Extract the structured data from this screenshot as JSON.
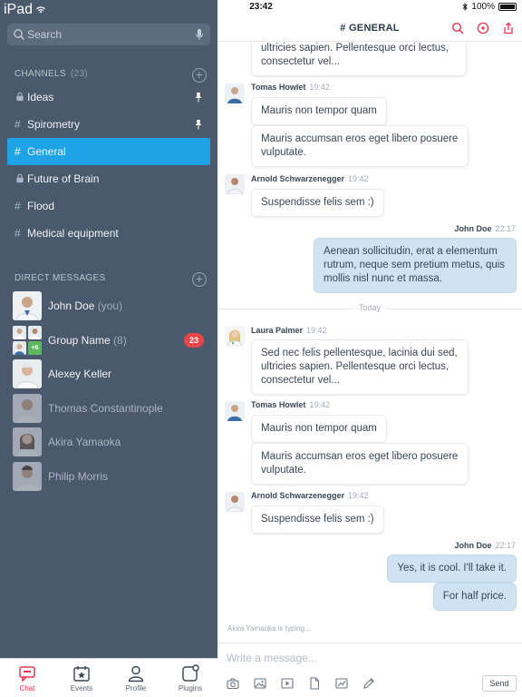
{
  "status_bar": {
    "carrier": "iPad",
    "time": "23:42",
    "battery": "100%"
  },
  "sidebar": {
    "search": {
      "placeholder": "Search"
    },
    "channels_header": {
      "label": "CHANNELS",
      "count": "(23)"
    },
    "channels": [
      {
        "prefix": "lock",
        "name": "Ideas",
        "pinned": true,
        "active": false
      },
      {
        "prefix": "#",
        "name": "Spirometry",
        "pinned": true,
        "active": false
      },
      {
        "prefix": "#",
        "name": "General",
        "pinned": false,
        "active": true
      },
      {
        "prefix": "lock",
        "name": "Future of Brain",
        "pinned": false,
        "active": false
      },
      {
        "prefix": "#",
        "name": "Flood",
        "pinned": false,
        "active": false
      },
      {
        "prefix": "#",
        "name": "Medical equipment",
        "pinned": false,
        "active": false
      }
    ],
    "dm_header": {
      "label": "DIRECT MESSAGES"
    },
    "direct_messages": [
      {
        "name": "John Doe",
        "sub": "(you)",
        "online": true
      },
      {
        "name": "Group Name",
        "sub": "(8)",
        "online": true,
        "badge": "23",
        "group_more": "+6"
      },
      {
        "name": "Alexey Keller",
        "sub": "",
        "online": true
      },
      {
        "name": "Thomas Constantinople",
        "sub": "",
        "online": false
      },
      {
        "name": "Akira Yamaoka",
        "sub": "",
        "online": false
      },
      {
        "name": "Philip Morris",
        "sub": "",
        "online": false
      }
    ]
  },
  "tabbar": {
    "tabs": [
      {
        "label": "Chat",
        "icon": "chat-icon",
        "active": true
      },
      {
        "label": "Events",
        "icon": "calendar-star-icon",
        "active": false
      },
      {
        "label": "Profile",
        "icon": "person-icon",
        "active": false
      },
      {
        "label": "Plugins",
        "icon": "plugin-icon",
        "active": false
      }
    ]
  },
  "chat": {
    "title": "# GENERAL",
    "header_icons": [
      "search-icon",
      "info-icon",
      "share-icon"
    ],
    "messages_top": {
      "partial_bubble": "ultricies sapien. Pellentesque orci lectus, consectetur vel...",
      "tomas": {
        "author": "Tomas Howlet",
        "time": "19:42",
        "bubbles": [
          "Mauris non tempor quam",
          "Mauris accumsan eros eget libero posuere vulputate."
        ]
      },
      "arnold": {
        "author": "Arnold Schwarzenegger",
        "time": "19:42",
        "bubbles": [
          "Suspendisse felis sem :)"
        ]
      },
      "own": {
        "author": "John Doe",
        "time": "22:17",
        "bubbles": [
          "Aenean sollicitudin, erat a elementum rutrum, neque sem pretium metus, quis mollis nisl nunc et massa."
        ]
      }
    },
    "divider_label": "Today",
    "messages_today": {
      "laura": {
        "author": "Laura Palmer",
        "time": "19:42",
        "bubbles": [
          "Sed nec felis pellentesque, lacinia dui sed, ultricies sapien. Pellentesque orci lectus, consectetur vel..."
        ]
      },
      "tomas": {
        "author": "Tomas Howlet",
        "time": "19:42",
        "bubbles": [
          "Mauris non tempor quam",
          "Mauris accumsan eros eget libero posuere vulputate."
        ]
      },
      "arnold": {
        "author": "Arnold Schwarzenegger",
        "time": "19:42",
        "bubbles": [
          "Suspendisse felis sem :)"
        ]
      },
      "own": {
        "author": "John Doe",
        "time": "22:17",
        "bubbles": [
          "Yes, it is cool. I'll take it.",
          "For half price."
        ]
      }
    },
    "typing": "Akira Yamaoka is typing...",
    "composer": {
      "placeholder": "Write a message...",
      "send_label": "Send",
      "tools": [
        "camera-icon",
        "image-icon",
        "video-icon",
        "file-icon",
        "chart-icon",
        "pencil-icon"
      ]
    }
  },
  "colors": {
    "sidebar_bg": "#4a596b",
    "active_channel": "#1ea3e6",
    "accent": "#e8334d",
    "own_bubble": "#cfe3f2",
    "badge": "#e84548"
  }
}
